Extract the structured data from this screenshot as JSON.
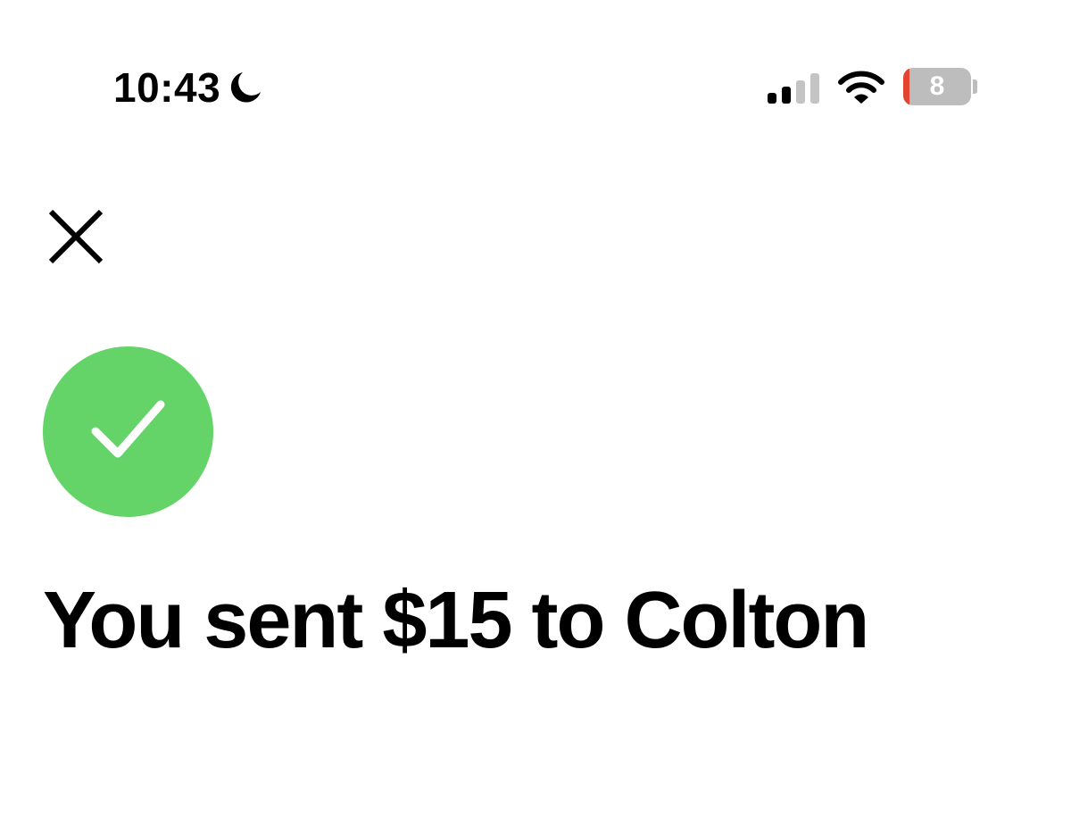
{
  "status_bar": {
    "time": "10:43",
    "focus_icon": "moon-icon",
    "signal_icon": "cellular-signal-icon",
    "wifi_icon": "wifi-icon",
    "battery_percent": "8",
    "battery_low_color": "#e2442f"
  },
  "nav": {
    "close_icon": "close-icon"
  },
  "confirmation": {
    "icon": "checkmark-icon",
    "accent_color": "#64d468",
    "title": "You sent $15 to Colton"
  }
}
